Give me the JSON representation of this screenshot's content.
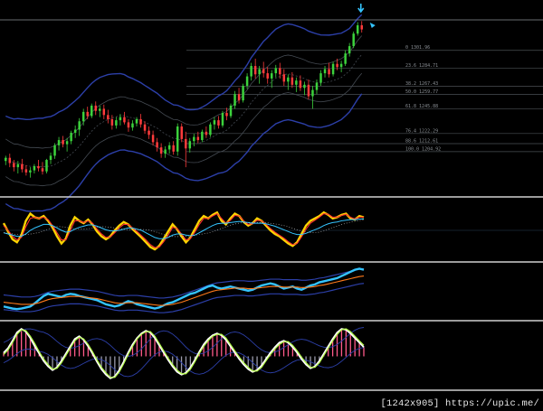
{
  "watermark": "[1242x905] https://upic.me/",
  "colors": {
    "background": "#000000",
    "separator": "#cfcfcf",
    "bull_candle": "#3cd23c",
    "bear_candle": "#ff3b3b",
    "fib_line": "#4a4f54",
    "envelope": "#2c3fa8",
    "bands": "#444a52",
    "fast_line": "#ff3030",
    "slow_line": "#ffd400",
    "signal_line": "#34c4ff",
    "osc_main": "#34c4ff",
    "osc_ma": "#ff7a1a",
    "hist_up": "#ff5a8a",
    "hist_dn": "#9a9aaa",
    "stoch_a": "#ffffff",
    "stoch_b": "#b6ff4a",
    "arrow": "#34c4ff"
  },
  "icons": [
    "down-arrow-icon",
    "signal-marker-icon"
  ],
  "chart_data": [
    {
      "type": "candlestick",
      "panel": "price",
      "title": "",
      "candles": [
        [
          1196,
          1201,
          1192,
          1199
        ],
        [
          1199,
          1203,
          1190,
          1194
        ],
        [
          1194,
          1197,
          1186,
          1190
        ],
        [
          1190,
          1196,
          1184,
          1193
        ],
        [
          1193,
          1198,
          1185,
          1188
        ],
        [
          1188,
          1192,
          1182,
          1185
        ],
        [
          1185,
          1190,
          1180,
          1187
        ],
        [
          1187,
          1193,
          1184,
          1191
        ],
        [
          1191,
          1197,
          1186,
          1189
        ],
        [
          1189,
          1195,
          1183,
          1186
        ],
        [
          1186,
          1198,
          1184,
          1197
        ],
        [
          1197,
          1204,
          1193,
          1201
        ],
        [
          1201,
          1213,
          1198,
          1211
        ],
        [
          1211,
          1219,
          1206,
          1216
        ],
        [
          1216,
          1220,
          1209,
          1212
        ],
        [
          1212,
          1218,
          1205,
          1215
        ],
        [
          1215,
          1225,
          1212,
          1223
        ],
        [
          1223,
          1230,
          1218,
          1226
        ],
        [
          1226,
          1237,
          1220,
          1234
        ],
        [
          1234,
          1246,
          1230,
          1243
        ],
        [
          1243,
          1248,
          1236,
          1239
        ],
        [
          1239,
          1251,
          1237,
          1249
        ],
        [
          1249,
          1253,
          1240,
          1244
        ],
        [
          1244,
          1249,
          1238,
          1246
        ],
        [
          1246,
          1250,
          1236,
          1240
        ],
        [
          1240,
          1245,
          1232,
          1236
        ],
        [
          1236,
          1240,
          1226,
          1230
        ],
        [
          1230,
          1238,
          1227,
          1235
        ],
        [
          1235,
          1241,
          1230,
          1238
        ],
        [
          1238,
          1243,
          1231,
          1233
        ],
        [
          1233,
          1236,
          1224,
          1228
        ],
        [
          1228,
          1235,
          1225,
          1232
        ],
        [
          1232,
          1238,
          1229,
          1236
        ],
        [
          1236,
          1241,
          1228,
          1231
        ],
        [
          1231,
          1234,
          1222,
          1225
        ],
        [
          1225,
          1229,
          1217,
          1221
        ],
        [
          1221,
          1225,
          1211,
          1214
        ],
        [
          1214,
          1218,
          1205,
          1209
        ],
        [
          1209,
          1213,
          1199,
          1203
        ],
        [
          1203,
          1210,
          1199,
          1207
        ],
        [
          1207,
          1214,
          1203,
          1211
        ],
        [
          1211,
          1215,
          1202,
          1205
        ],
        [
          1205,
          1232,
          1201,
          1229
        ],
        [
          1229,
          1232,
          1214,
          1217
        ],
        [
          1217,
          1224,
          1190,
          1208
        ],
        [
          1208,
          1218,
          1204,
          1215
        ],
        [
          1215,
          1222,
          1210,
          1219
        ],
        [
          1219,
          1224,
          1213,
          1216
        ],
        [
          1216,
          1226,
          1214,
          1224
        ],
        [
          1224,
          1229,
          1218,
          1221
        ],
        [
          1221,
          1233,
          1219,
          1231
        ],
        [
          1231,
          1238,
          1226,
          1235
        ],
        [
          1235,
          1239,
          1227,
          1230
        ],
        [
          1230,
          1244,
          1228,
          1242
        ],
        [
          1242,
          1247,
          1235,
          1239
        ],
        [
          1239,
          1251,
          1237,
          1249
        ],
        [
          1249,
          1263,
          1246,
          1260
        ],
        [
          1260,
          1266,
          1251,
          1254
        ],
        [
          1254,
          1270,
          1252,
          1268
        ],
        [
          1268,
          1280,
          1265,
          1277
        ],
        [
          1277,
          1290,
          1273,
          1287
        ],
        [
          1287,
          1294,
          1275,
          1279
        ],
        [
          1279,
          1287,
          1270,
          1284
        ],
        [
          1284,
          1291,
          1276,
          1280
        ],
        [
          1280,
          1286,
          1270,
          1275
        ],
        [
          1275,
          1283,
          1266,
          1280
        ],
        [
          1280,
          1288,
          1276,
          1285
        ],
        [
          1285,
          1290,
          1275,
          1279
        ],
        [
          1279,
          1284,
          1268,
          1272
        ],
        [
          1272,
          1279,
          1264,
          1276
        ],
        [
          1276,
          1281,
          1266,
          1269
        ],
        [
          1269,
          1276,
          1262,
          1273
        ],
        [
          1273,
          1278,
          1263,
          1266
        ],
        [
          1266,
          1272,
          1259,
          1269
        ],
        [
          1269,
          1274,
          1255,
          1258
        ],
        [
          1258,
          1268,
          1246,
          1264
        ],
        [
          1264,
          1274,
          1260,
          1271
        ],
        [
          1271,
          1283,
          1268,
          1280
        ],
        [
          1280,
          1287,
          1276,
          1284
        ],
        [
          1284,
          1290,
          1276,
          1279
        ],
        [
          1279,
          1291,
          1277,
          1289
        ],
        [
          1289,
          1294,
          1283,
          1286
        ],
        [
          1286,
          1292,
          1281,
          1289
        ],
        [
          1289,
          1302,
          1287,
          1299
        ],
        [
          1299,
          1309,
          1296,
          1306
        ],
        [
          1306,
          1320,
          1304,
          1318
        ],
        [
          1318,
          1329,
          1316,
          1326
        ],
        [
          1326,
          1330,
          1319,
          1322
        ]
      ],
      "fibonacci": [
        {
          "label": "0 1301.96",
          "value": 1301.96
        },
        {
          "label": "23.6 1284.71",
          "value": 1284.71
        },
        {
          "label": "38.2 1267.43",
          "value": 1267.43
        },
        {
          "label": "50.0 1259.77",
          "value": 1259.77
        },
        {
          "label": "61.8 1245.88",
          "value": 1245.88
        },
        {
          "label": "76.4 1222.29",
          "value": 1222.29
        },
        {
          "label": "88.6 1212.61",
          "value": 1212.61
        },
        {
          "label": "100.0 1204.92",
          "value": 1204.92
        }
      ],
      "ylim": [
        1165,
        1345
      ],
      "grid": false,
      "legend": "none"
    },
    {
      "type": "line",
      "panel": "oscillator-1",
      "series": [
        {
          "values": [
            62,
            48,
            35,
            30,
            42,
            66,
            78,
            72,
            70,
            74,
            66,
            55,
            40,
            28,
            36,
            58,
            72,
            66,
            62,
            68,
            60,
            48,
            40,
            35,
            40,
            50,
            58,
            64,
            60,
            52,
            45,
            38,
            30,
            22,
            18,
            24,
            36,
            48,
            60,
            52,
            40,
            30,
            38,
            52,
            66,
            74,
            70,
            76,
            80,
            66,
            60,
            70,
            78,
            74,
            64,
            58,
            62,
            70,
            66,
            58,
            50,
            44,
            40,
            34,
            28,
            24,
            30,
            44,
            58,
            66,
            70,
            74,
            80,
            76,
            70,
            72,
            76,
            78,
            70,
            68,
            74,
            72
          ]
        },
        {
          "values": [
            58,
            50,
            40,
            34,
            38,
            56,
            70,
            72,
            70,
            72,
            68,
            58,
            46,
            34,
            34,
            50,
            66,
            66,
            63,
            66,
            62,
            52,
            44,
            38,
            39,
            46,
            54,
            60,
            60,
            54,
            48,
            41,
            34,
            26,
            21,
            22,
            31,
            42,
            55,
            53,
            44,
            34,
            36,
            47,
            60,
            70,
            70,
            74,
            78,
            70,
            62,
            67,
            75,
            74,
            66,
            60,
            61,
            67,
            66,
            60,
            53,
            47,
            42,
            37,
            31,
            26,
            28,
            39,
            52,
            62,
            67,
            72,
            78,
            77,
            72,
            72,
            75,
            77,
            72,
            69,
            72,
            72
          ]
        },
        {
          "values": [
            46,
            44,
            42,
            40,
            40,
            44,
            50,
            54,
            57,
            60,
            60,
            58,
            54,
            50,
            47,
            48,
            52,
            55,
            57,
            59,
            59,
            57,
            54,
            51,
            49,
            49,
            50,
            52,
            54,
            54,
            52,
            50,
            46,
            42,
            38,
            36,
            36,
            38,
            42,
            44,
            44,
            42,
            41,
            42,
            46,
            50,
            54,
            58,
            61,
            62,
            62,
            63,
            64,
            65,
            64,
            63,
            62,
            62,
            62,
            61,
            59,
            57,
            54,
            51,
            48,
            45,
            43,
            43,
            45,
            48,
            51,
            54,
            58,
            61,
            63,
            64,
            66,
            67,
            68,
            68,
            69,
            69
          ]
        }
      ],
      "ylim": [
        0,
        100
      ]
    },
    {
      "type": "line",
      "panel": "oscillator-2",
      "series": [
        {
          "values": [
            22,
            20,
            18,
            17,
            18,
            20,
            22,
            28,
            35,
            42,
            46,
            44,
            42,
            40,
            44,
            46,
            45,
            42,
            40,
            38,
            36,
            34,
            30,
            26,
            24,
            22,
            24,
            28,
            32,
            30,
            26,
            24,
            22,
            20,
            18,
            20,
            24,
            28,
            30,
            34,
            38,
            42,
            46,
            48,
            52,
            56,
            60,
            62,
            58,
            56,
            58,
            60,
            58,
            56,
            54,
            52,
            54,
            58,
            62,
            64,
            66,
            64,
            60,
            56,
            58,
            60,
            56,
            54,
            58,
            62,
            64,
            68,
            70,
            72,
            74,
            76,
            80,
            84,
            88,
            92,
            94,
            92
          ]
        },
        {
          "values": [
            30,
            29,
            28,
            27,
            26,
            26,
            26,
            27,
            29,
            32,
            35,
            37,
            38,
            39,
            40,
            41,
            41,
            41,
            40,
            39,
            38,
            37,
            35,
            33,
            31,
            29,
            28,
            28,
            29,
            29,
            29,
            28,
            27,
            26,
            25,
            24,
            24,
            25,
            26,
            28,
            30,
            33,
            36,
            39,
            42,
            45,
            48,
            51,
            53,
            54,
            55,
            56,
            57,
            57,
            57,
            56,
            56,
            57,
            58,
            59,
            60,
            60,
            60,
            59,
            59,
            59,
            59,
            58,
            58,
            59,
            60,
            62,
            63,
            65,
            67,
            69,
            71,
            73,
            75,
            77,
            79,
            80
          ]
        }
      ],
      "ylim": [
        0,
        100
      ]
    },
    {
      "type": "bar",
      "panel": "oscillator-3",
      "series": [
        {
          "values": [
            8,
            18,
            34,
            52,
            60,
            54,
            40,
            22,
            6,
            -10,
            -22,
            -30,
            -24,
            -10,
            6,
            22,
            38,
            44,
            36,
            22,
            6,
            -12,
            -28,
            -40,
            -48,
            -44,
            -30,
            -12,
            8,
            26,
            40,
            50,
            56,
            52,
            40,
            24,
            8,
            -8,
            -22,
            -34,
            -40,
            -36,
            -24,
            -8,
            10,
            26,
            38,
            46,
            50,
            46,
            36,
            22,
            8,
            -6,
            -18,
            -28,
            -34,
            -30,
            -20,
            -6,
            8,
            20,
            30,
            34,
            30,
            20,
            8,
            -6,
            -18,
            -26,
            -22,
            -10,
            6,
            22,
            38,
            52,
            60,
            58,
            50,
            40,
            30,
            20
          ]
        },
        {
          "values": [
            4,
            14,
            30,
            48,
            58,
            56,
            44,
            28,
            10,
            -6,
            -18,
            -28,
            -26,
            -14,
            2,
            18,
            34,
            42,
            38,
            26,
            10,
            -8,
            -24,
            -36,
            -46,
            -46,
            -34,
            -16,
            4,
            22,
            38,
            48,
            54,
            54,
            44,
            28,
            12,
            -4,
            -18,
            -30,
            -38,
            -38,
            -28,
            -12,
            6,
            22,
            34,
            44,
            48,
            48,
            40,
            26,
            12,
            -2,
            -14,
            -24,
            -32,
            -32,
            -24,
            -10,
            4,
            16,
            26,
            32,
            32,
            24,
            12,
            -2,
            -14,
            -24,
            -24,
            -14,
            2,
            18,
            34,
            48,
            58,
            60,
            54,
            44,
            34,
            24
          ]
        }
      ],
      "ylim": [
        -70,
        70
      ]
    }
  ]
}
